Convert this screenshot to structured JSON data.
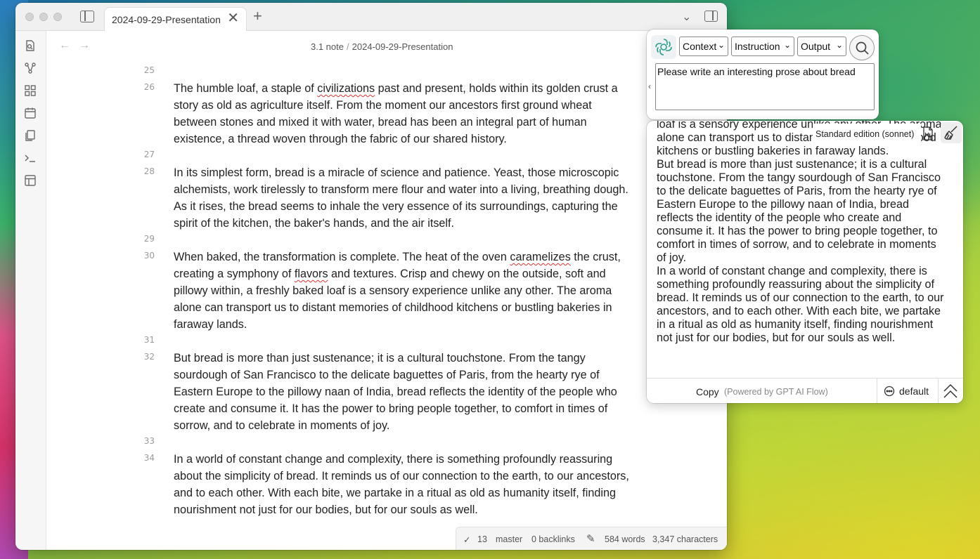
{
  "window": {
    "tab_title": "2024-09-29-Presentation",
    "tab_close": "✕",
    "tab_add": "+",
    "tab_list": "⌄"
  },
  "nav": {
    "back": "←",
    "forward": "→"
  },
  "breadcrumb": {
    "folder": "3.1 note",
    "separator": "/",
    "file": "2024-09-29-Presentation"
  },
  "editor": {
    "lines": [
      {
        "num": "25",
        "text": ""
      },
      {
        "num": "26",
        "text": "The humble loaf, a staple of civilizations past and present, holds within its golden crust a story as old as agriculture itself. From the moment our ancestors first ground wheat between stones and mixed it with water, bread has been an integral part of human existence, a thread woven through the fabric of our shared history."
      },
      {
        "num": "27",
        "text": ""
      },
      {
        "num": "28",
        "text": "In its simplest form, bread is a miracle of science and patience. Yeast, those microscopic alchemists, work tirelessly to transform mere flour and water into a living, breathing dough. As it rises, the bread seems to inhale the very essence of its surroundings, capturing the spirit of the kitchen, the baker's hands, and the air itself."
      },
      {
        "num": "29",
        "text": ""
      },
      {
        "num": "30",
        "text": "When baked, the transformation is complete. The heat of the oven caramelizes the crust, creating a symphony of flavors and textures. Crisp and chewy on the outside, soft and pillowy within, a freshly baked loaf is a sensory experience unlike any other. The aroma alone can transport us to distant memories of childhood kitchens or bustling bakeries in faraway lands."
      },
      {
        "num": "31",
        "text": ""
      },
      {
        "num": "32",
        "text": "But bread is more than just sustenance; it is a cultural touchstone. From the tangy sourdough of San Francisco to the delicate baguettes of Paris, from the hearty rye of Eastern Europe to the pillowy naan of India, bread reflects the identity of the people who create and consume it. It has the power to bring people together, to comfort in times of sorrow, and to celebrate in moments of joy."
      },
      {
        "num": "33",
        "text": ""
      },
      {
        "num": "34",
        "text": "In a world of constant change and complexity, there is something profoundly reassuring about the simplicity of bread. It reminds us of our connection to the earth, to our ancestors, and to each other. With each bite, we partake in a ritual as old as humanity itself, finding nourishment not just for our bodies, but for our souls as well."
      }
    ]
  },
  "statusbar": {
    "sync_icon": "✓",
    "sync_count": "13",
    "branch": "master",
    "backlinks": "0 backlinks",
    "edit_icon": "✎",
    "words": "584 words",
    "characters": "3,347 characters"
  },
  "plugin": {
    "dropdowns": {
      "context": "Context",
      "instruction": "Instruction",
      "output": "Output"
    },
    "chevron": "⌄",
    "collapse": "‹",
    "prompt": "Please write an interesting prose about bread",
    "model": "Standard edition (sonnet)",
    "output_paragraphs": [
      "loaf is a sensory experience unlike any other. The aroma alone can transport us to distant memories of childhood kitchens or bustling bakeries in faraway lands.",
      "But bread is more than just sustenance; it is a cultural touchstone. From the tangy sourdough of San Francisco to the delicate baguettes of Paris, from the hearty rye of Eastern Europe to the pillowy naan of India, bread reflects the identity of the people who create and consume it. It has the power to bring people together, to comfort in times of sorrow, and to celebrate in moments of joy.",
      "In a world of constant change and complexity, there is something profoundly reassuring about the simplicity of bread. It reminds us of our connection to the earth, to our ancestors, and to each other. With each bite, we partake in a ritual as old as humanity itself, finding nourishment not just for our bodies, but for our souls as well."
    ],
    "copy": "Copy",
    "powered": "(Powered by GPT AI Flow)",
    "mode": "default"
  }
}
